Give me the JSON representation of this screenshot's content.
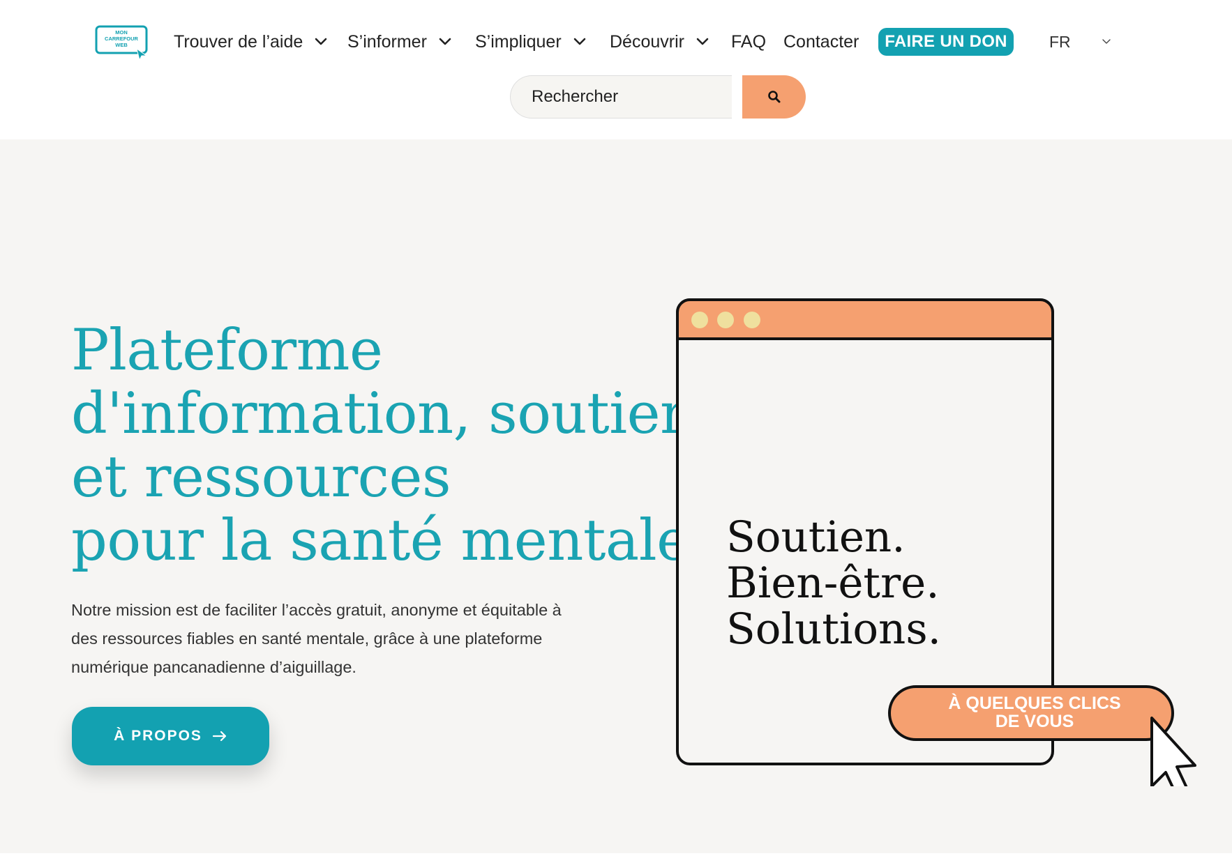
{
  "brand": {
    "logo_lines": [
      "MON",
      "CARREFOUR",
      "WEB"
    ],
    "accent_color": "#13a1b1",
    "orange_color": "#f5a070",
    "background_color": "#f6f5f3"
  },
  "nav": {
    "items": [
      {
        "label": "Trouver de l’aide",
        "has_dropdown": true
      },
      {
        "label": "S’informer",
        "has_dropdown": true
      },
      {
        "label": "S’impliquer",
        "has_dropdown": true
      },
      {
        "label": "Découvrir",
        "has_dropdown": true
      },
      {
        "label": "FAQ",
        "has_dropdown": false
      },
      {
        "label": "Contacter",
        "has_dropdown": false
      }
    ],
    "donate_label": "FAIRE UN DON",
    "language": "FR"
  },
  "search": {
    "placeholder": "Rechercher",
    "button_icon": "search-icon"
  },
  "hero": {
    "title_lines": [
      "Plateforme",
      "d'information, soutien",
      "et ressources",
      "pour la santé mentale"
    ],
    "description": "Notre mission est de faciliter l’accès gratuit, anonyme et équitable à des ressources fiables en santé mentale, grâce à une plateforme numérique pancanadienne d’aiguillage.",
    "cta_label": "À PROPOS",
    "cta_icon": "arrow-right-icon"
  },
  "illustration": {
    "slogan_lines": [
      "Soutien.",
      "Bien-être.",
      "Solutions."
    ],
    "pill_lines": [
      "À QUELQUES CLICS",
      "DE VOUS"
    ],
    "cursor_icon": "cursor-pointer-icon"
  }
}
